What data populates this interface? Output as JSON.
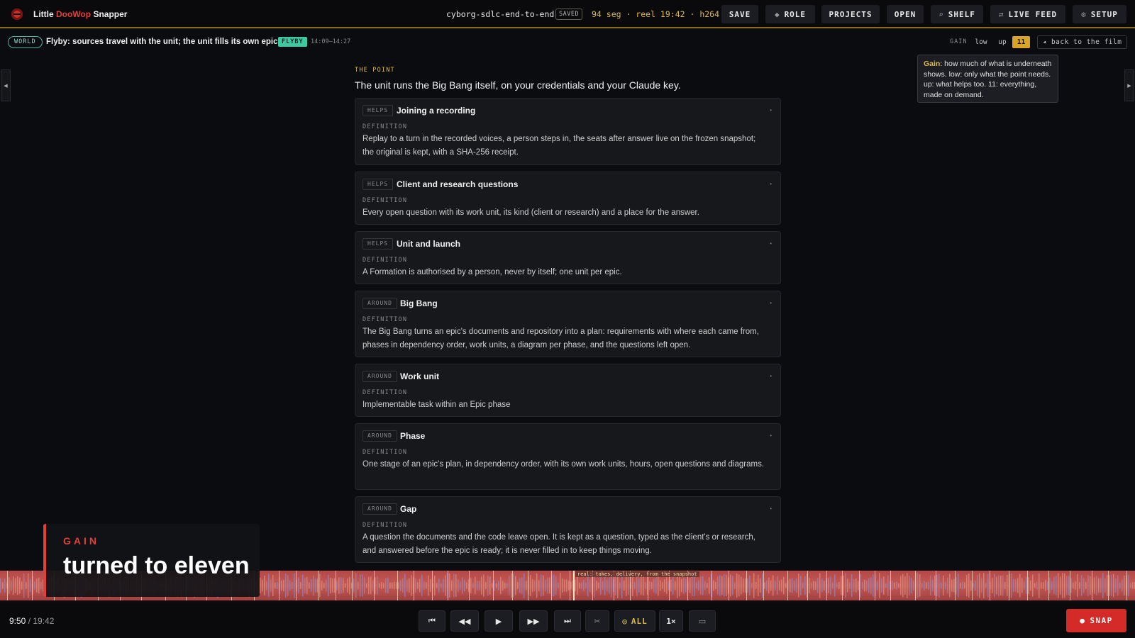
{
  "app": {
    "brand_prefix": "Little ",
    "brand_accent": "DooWop",
    "brand_suffix": " Snapper",
    "accent_color": "#e0403a",
    "gold_color": "#d9b948"
  },
  "topbar": {
    "project": "cyborg-sdlc-end-to-end",
    "saved": "SAVED",
    "reel_info": "94 seg · reel 19:42 · h264",
    "buttons": {
      "save": "SAVE",
      "role": "ROLE",
      "projects": "PROJECTS",
      "open": "OPEN",
      "shelf": "SHELF",
      "live_feed": "LIVE FEED",
      "setup": "SETUP"
    }
  },
  "subbar": {
    "world": "WORLD",
    "flyby_title": "Flyby: sources travel with the unit; the unit fills its own epic",
    "flyby_badge": "FLYBY",
    "flyby_time": "14:09–14:27",
    "gain_label": "GAIN",
    "gain_low": "low",
    "gain_up": "up",
    "gain_11": "11",
    "back": "◂ back to the film"
  },
  "tooltip": {
    "term": "Gain",
    "text": ": how much of what is underneath shows. low: only what the point needs. up: what helps too. 11: everything, made on demand."
  },
  "main": {
    "kicker": "THE POINT",
    "point": "The unit runs the Big Bang itself, on your credentials and your Claude key.",
    "definition_label": "DEFINITION",
    "cards": [
      {
        "tag": "HELPS",
        "title": "Joining a recording",
        "body": "Replay to a turn in the recorded voices, a person steps in, the seats after answer live on the frozen snapshot; the original is kept, with a SHA-256 receipt."
      },
      {
        "tag": "HELPS",
        "title": "Client and research questions",
        "body": "Every open question with its work unit, its kind (client or research) and a place for the answer."
      },
      {
        "tag": "HELPS",
        "title": "Unit and launch",
        "body": "A Formation is authorised by a person, never by itself; one unit per epic."
      },
      {
        "tag": "AROUND",
        "title": "Big Bang",
        "body": "The Big Bang turns an epic's documents and repository into a plan: requirements with where each came from, phases in dependency order, work units, a diagram per phase, and the questions left open."
      },
      {
        "tag": "AROUND",
        "title": "Work unit",
        "body": "Implementable task within an Epic phase"
      },
      {
        "tag": "AROUND",
        "title": "Phase",
        "body": "One stage of an epic's plan, in dependency order, with its own work units, hours, open questions and diagrams."
      },
      {
        "tag": "AROUND",
        "title": "Gap",
        "body": "A question the documents and the code leave open. It is kept as a question, typed as the client's or research, and answered before the epic is ready; it is never filled in to keep things moving."
      }
    ]
  },
  "gain_overlay": {
    "kicker": "GAIN",
    "text": "turned to eleven"
  },
  "timeline": {
    "caption": "real: takes, delivery, from the snapshot",
    "progress": 0.505
  },
  "playback": {
    "current": "9:50",
    "separator": " / ",
    "total": "19:42",
    "all": "ALL",
    "speed": "1×",
    "snap": "SNAP"
  }
}
